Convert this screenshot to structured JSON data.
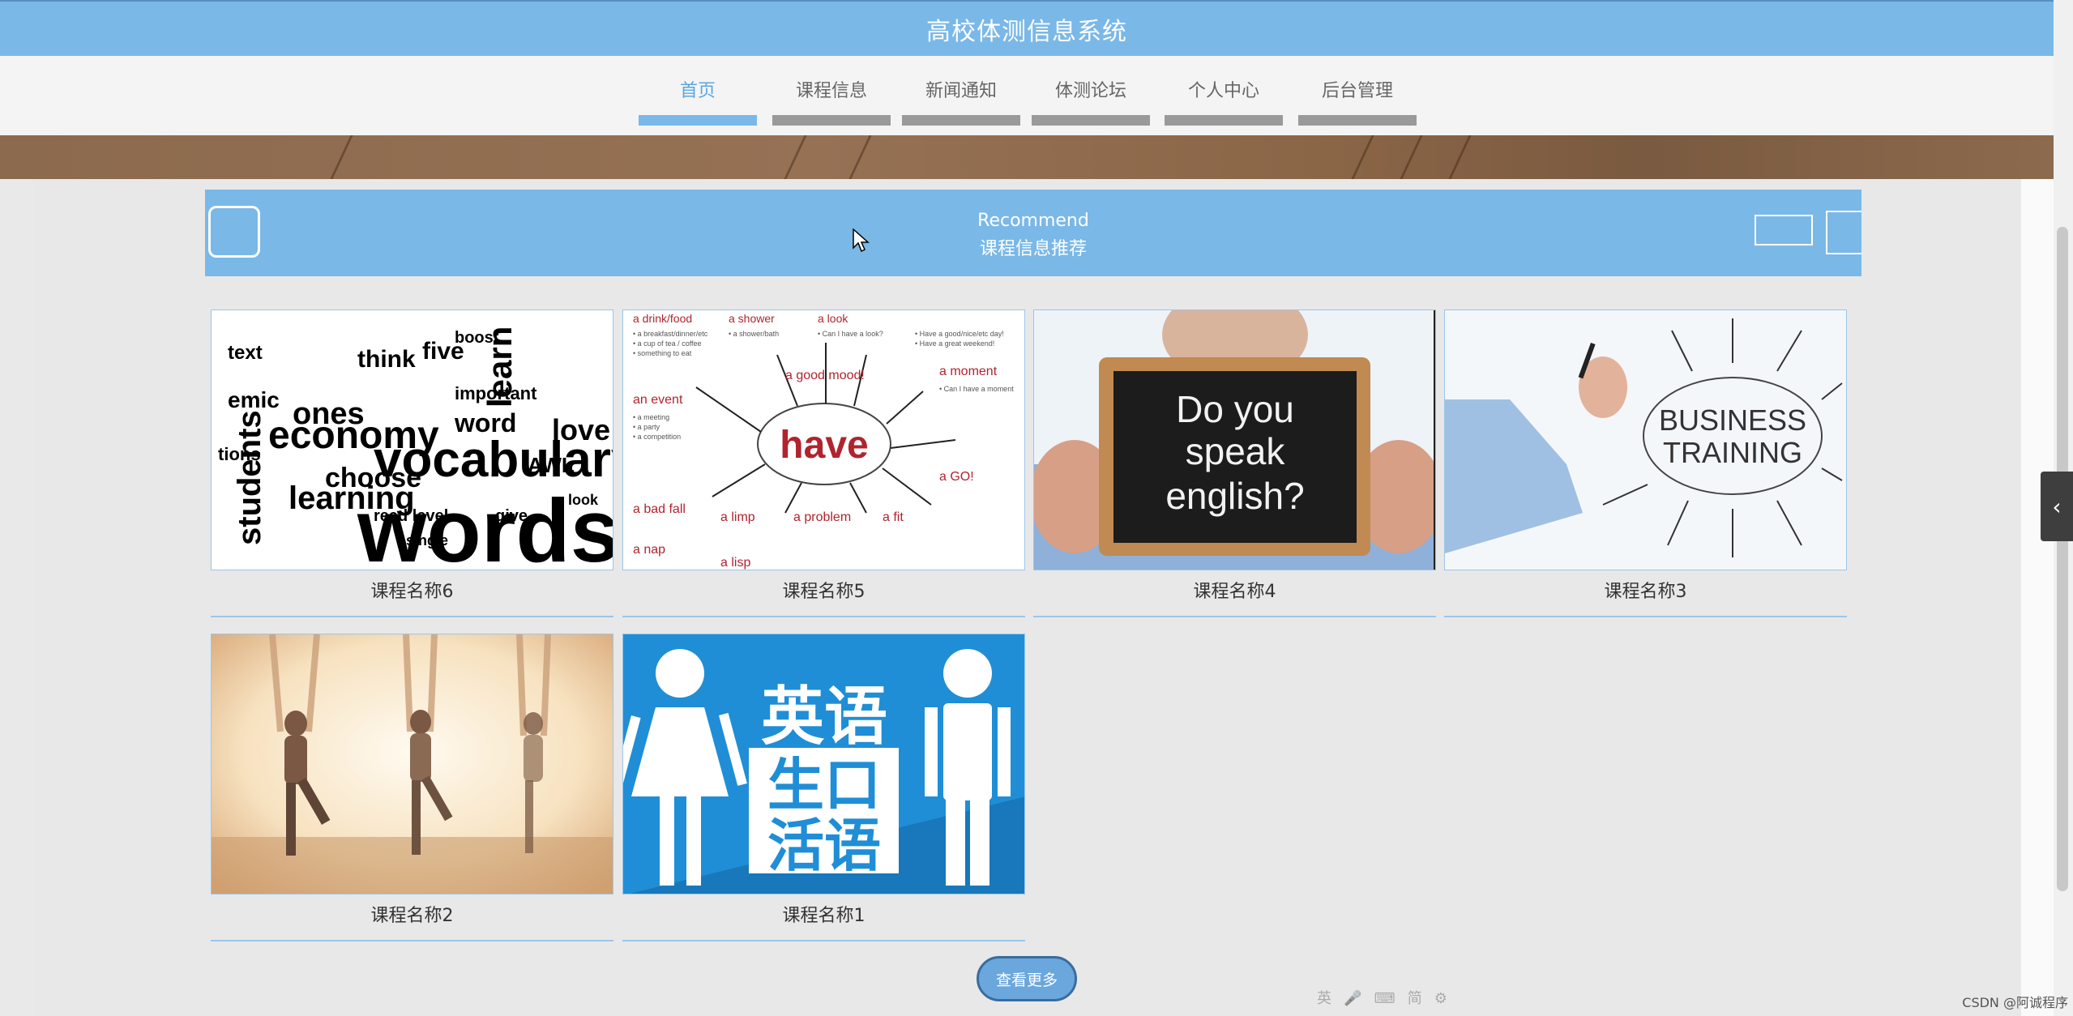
{
  "header": {
    "title": "高校体测信息系统"
  },
  "nav": {
    "items": [
      {
        "label": "首页",
        "active": true
      },
      {
        "label": "课程信息",
        "active": false
      },
      {
        "label": "新闻通知",
        "active": false
      },
      {
        "label": "体测论坛",
        "active": false
      },
      {
        "label": "个人中心",
        "active": false
      },
      {
        "label": "后台管理",
        "active": false
      }
    ]
  },
  "recommend": {
    "title_en": "Recommend",
    "title_cn": "课程信息推荐"
  },
  "courses": [
    {
      "name": "课程名称6",
      "image": "word-cloud-vocabulary-image"
    },
    {
      "name": "课程名称5",
      "image": "have-mind-map-image"
    },
    {
      "name": "课程名称4",
      "image": "do-you-speak-english-image",
      "image_text": [
        "Do you",
        "speak",
        "english?"
      ]
    },
    {
      "name": "课程名称3",
      "image": "business-training-image",
      "image_text": [
        "BUSINESS",
        "TRAINING"
      ]
    },
    {
      "name": "课程名称2",
      "image": "aerial-yoga-image"
    },
    {
      "name": "课程名称1",
      "image": "english-spoken-poster-image",
      "image_text": [
        "英语",
        "生口",
        "活语"
      ]
    }
  ],
  "more_button": {
    "label": "查看更多"
  },
  "ime": {
    "items": [
      "英",
      "简"
    ]
  },
  "watermark": "CSDN @阿诚程序",
  "colors": {
    "accent": "#7ab8e8",
    "banner": "#8c6a4d",
    "nav_bar_inactive": "#9a9a9a"
  }
}
